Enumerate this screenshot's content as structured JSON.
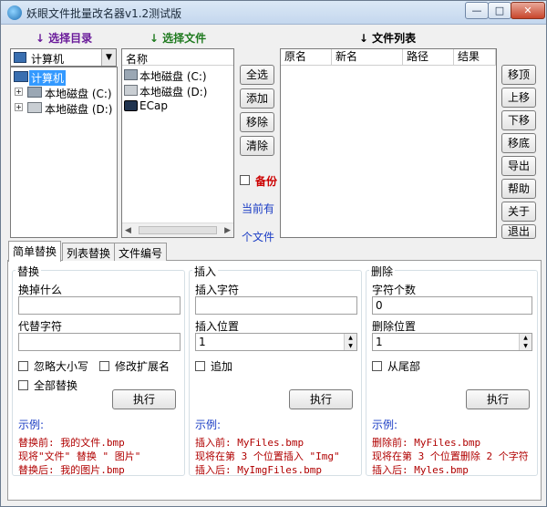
{
  "window": {
    "title": "妖眼文件批量改名器v1.2测试版",
    "minimize": "—",
    "maximize": "□",
    "close": "✕"
  },
  "panels": {
    "dir_header": "↓ 选择目录",
    "file_header": "↓ 选择文件",
    "list_header": "↓ 文件列表"
  },
  "dir": {
    "combo_value": "计算机",
    "tree": [
      {
        "label": "计算机"
      },
      {
        "label": "本地磁盘 (C:)"
      },
      {
        "label": "本地磁盘 (D:)"
      }
    ]
  },
  "files": {
    "column": "名称",
    "items": [
      {
        "label": "本地磁盘 (C:)"
      },
      {
        "label": "本地磁盘 (D:)"
      },
      {
        "label": "ECap"
      }
    ]
  },
  "middle_buttons": {
    "select_all": "全选",
    "add": "添加",
    "remove": "移除",
    "clear": "清除"
  },
  "backup": {
    "label": "备份",
    "checked": false
  },
  "status": {
    "current": "当前有",
    "files": "个文件"
  },
  "list": {
    "columns": [
      "原名",
      "新名",
      "路径",
      "结果"
    ]
  },
  "right_buttons": {
    "top": "移顶",
    "up": "上移",
    "down": "下移",
    "bottom": "移底",
    "export": "导出",
    "help": "帮助",
    "about": "关于",
    "exit": "退出"
  },
  "tabs": [
    {
      "label": "简单替换",
      "active": true
    },
    {
      "label": "列表替换"
    },
    {
      "label": "文件编号"
    }
  ],
  "replace": {
    "title": "替换",
    "find_label": "换掉什么",
    "find_value": "",
    "replace_label": "代替字符",
    "replace_value": "",
    "ignore_case": "忽略大小写",
    "modify_ext": "修改扩展名",
    "replace_all": "全部替换",
    "exec": "执行",
    "example_title": "示例:",
    "examples": [
      "替换前: 我的文件.bmp",
      "现将\"文件\" 替换 \" 图片\"",
      "替换后: 我的图片.bmp"
    ]
  },
  "insert": {
    "title": "插入",
    "chars_label": "插入字符",
    "chars_value": "",
    "pos_label": "插入位置",
    "pos_value": "1",
    "append": "追加",
    "exec": "执行",
    "example_title": "示例:",
    "examples": [
      "插入前: MyFiles.bmp",
      "现将在第 3 个位置插入 \"Img\"",
      "插入后: MyImgFiles.bmp"
    ]
  },
  "delete": {
    "title": "删除",
    "count_label": "字符个数",
    "count_value": "0",
    "pos_label": "删除位置",
    "pos_value": "1",
    "from_end": "从尾部",
    "exec": "执行",
    "example_title": "示例:",
    "examples": [
      "删除前: MyFiles.bmp",
      "现将在第 3 个位置删除 2 个字符",
      "插入后: Myles.bmp"
    ]
  }
}
